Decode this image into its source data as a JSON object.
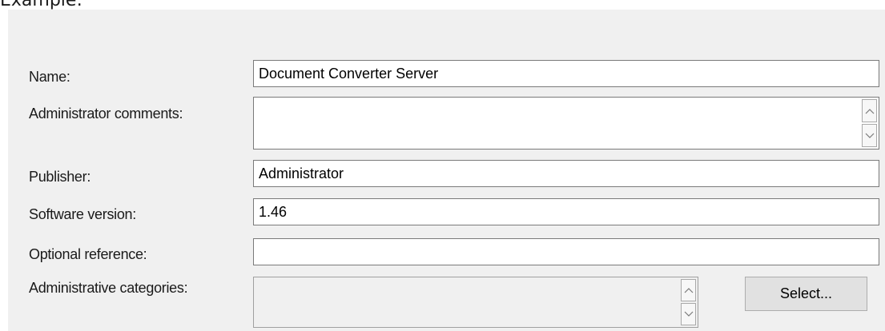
{
  "caption": "Example:",
  "form": {
    "name_label": "Name:",
    "name_value": "Document Converter Server",
    "comments_label": "Administrator comments:",
    "comments_value": "",
    "publisher_label": "Publisher:",
    "publisher_value": "Administrator",
    "version_label": "Software version:",
    "version_value": "1.46",
    "reference_label": "Optional reference:",
    "reference_value": "",
    "categories_label": "Administrative categories:",
    "select_button": "Select..."
  },
  "icons": {
    "scroll_up": "chevron-up-icon",
    "scroll_down": "chevron-down-icon"
  }
}
